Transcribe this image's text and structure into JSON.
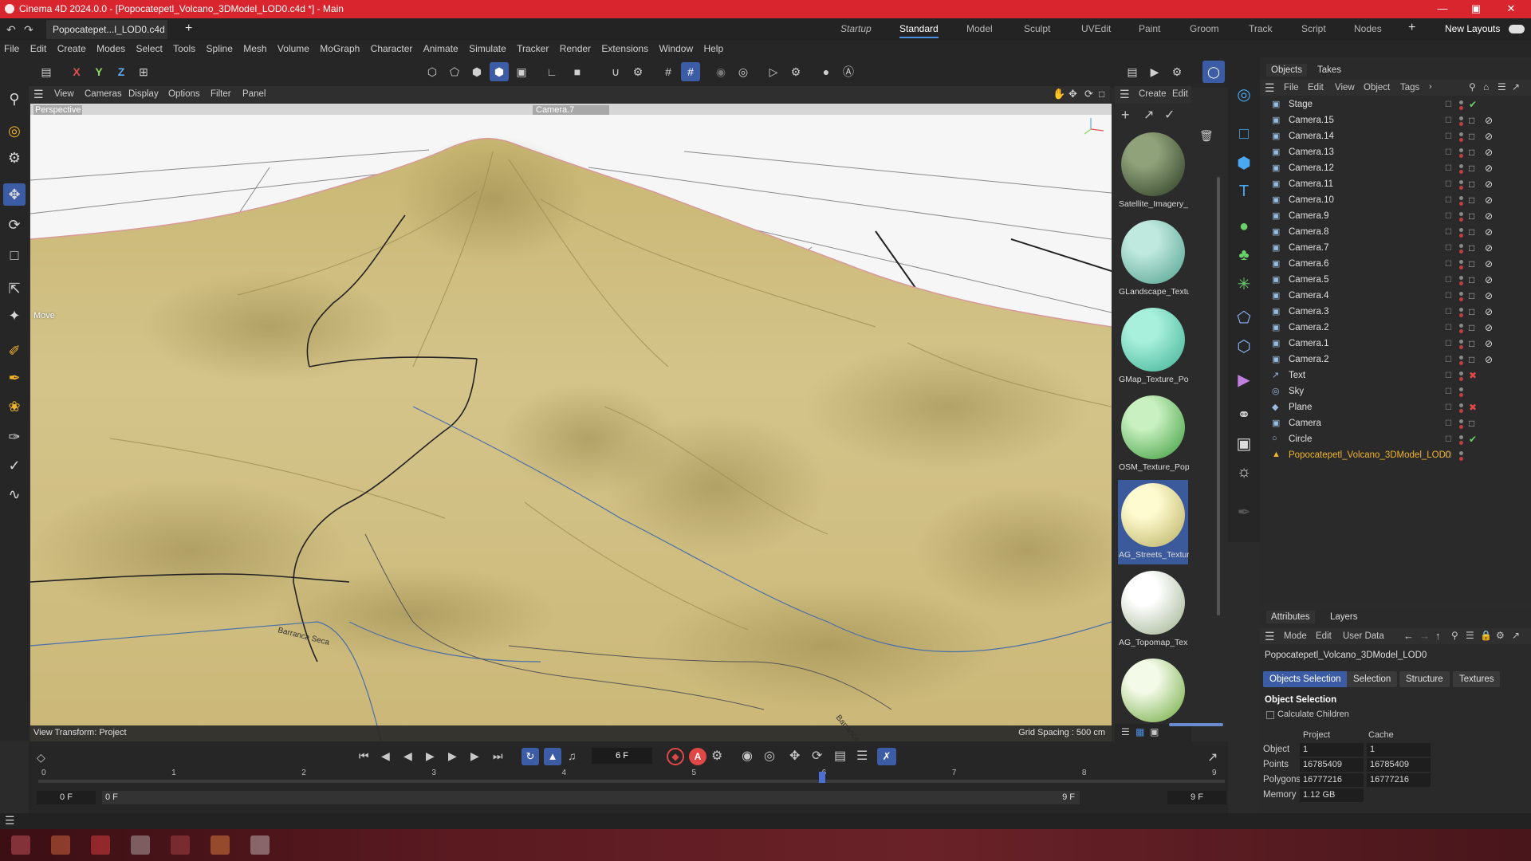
{
  "app": {
    "title": "Cinema 4D 2024.0.0 - [Popocatepetl_Volcano_3DModel_LOD0.c4d *] - Main",
    "doc_tab": "Popocatepet...l_LOD0.c4d *",
    "accent_color": "#3d5ca6",
    "title_bar_color": "#d9262e"
  },
  "layouts": [
    "Startup",
    "Standard",
    "Model",
    "Sculpt",
    "UVEdit",
    "Paint",
    "Groom",
    "Track",
    "Script",
    "Nodes"
  ],
  "new_layouts": "New Layouts",
  "menu": [
    "File",
    "Edit",
    "Create",
    "Modes",
    "Select",
    "Tools",
    "Spline",
    "Mesh",
    "Volume",
    "MoGraph",
    "Character",
    "Animate",
    "Simulate",
    "Tracker",
    "Render",
    "Extensions",
    "Window",
    "Help"
  ],
  "axis_buttons": {
    "x": "X",
    "y": "Y",
    "z": "Z"
  },
  "viewport": {
    "menu": [
      "View",
      "Cameras",
      "Display",
      "Options",
      "Filter",
      "Panel"
    ],
    "name": "Perspective",
    "camera": "Camera.7",
    "hud_move": "Move",
    "view_transform": "View Transform: Project",
    "grid_spacing": "Grid Spacing : 500 cm",
    "road_label_1": "Barranca Seca",
    "road_label_2": "Barranca Sa"
  },
  "materials": {
    "menu": [
      "Create",
      "Edit"
    ],
    "items": [
      {
        "label": "Satellite_Imagery_",
        "c1": "#8fa27a",
        "c2": "#2a3a22"
      },
      {
        "label": "GLandscape_Textu",
        "c1": "#bfe8de",
        "c2": "#4fa08e"
      },
      {
        "label": "GMap_Texture_Po",
        "c1": "#a8f0dc",
        "c2": "#3fb094"
      },
      {
        "label": "OSM_Texture_Pop",
        "c1": "#c8f0c0",
        "c2": "#3a9a3a"
      },
      {
        "label": "AG_Streets_Textur",
        "c1": "#fffbd0",
        "c2": "#b8ae60"
      },
      {
        "label": "AG_Topomap_Tex",
        "c1": "#ffffff",
        "c2": "#9aae8a"
      },
      {
        "label": "",
        "c1": "#f4fae8",
        "c2": "#6aa83a"
      }
    ]
  },
  "objects": {
    "tabs": [
      "Objects",
      "Takes"
    ],
    "menu": [
      "File",
      "Edit",
      "View",
      "Object",
      "Tags"
    ],
    "items": [
      "Stage",
      "Camera.15",
      "Camera.14",
      "Camera.13",
      "Camera.12",
      "Camera.11",
      "Camera.10",
      "Camera.9",
      "Camera.8",
      "Camera.7",
      "Camera.6",
      "Camera.5",
      "Camera.4",
      "Camera.3",
      "Camera.2",
      "Camera.1",
      "Camera.2",
      "Text",
      "Sky",
      "Plane",
      "Camera",
      "Circle",
      "Popocatepetl_Volcano_3DModel_LOD0"
    ],
    "highlight_color": "#f0b429"
  },
  "attributes": {
    "tabs": [
      "Attributes",
      "Layers"
    ],
    "menu": [
      "Mode",
      "Edit",
      "User Data"
    ],
    "object_name": "Popocatepetl_Volcano_3DModel_LOD0",
    "buttons": [
      "Objects Selection",
      "Selection",
      "Structure",
      "Textures"
    ],
    "section": "Object Selection",
    "calc_children": "Calculate Children",
    "col_project": "Project",
    "col_cache": "Cache",
    "rows": [
      {
        "label": "Object",
        "project": "1",
        "cache": "1"
      },
      {
        "label": "Points",
        "project": "16785409",
        "cache": "16785409"
      },
      {
        "label": "Polygons",
        "project": "16777216",
        "cache": "16777216"
      },
      {
        "label": "Memory",
        "project": "1.12 GB",
        "cache": ""
      }
    ]
  },
  "timeline": {
    "current_frame": "6 F",
    "start": "0 F",
    "start2": "0 F",
    "end": "9 F",
    "end2": "9 F",
    "ticks": [
      "0",
      "1",
      "2",
      "3",
      "4",
      "5",
      "6",
      "7",
      "8",
      "9"
    ],
    "playhead_frame": 6
  }
}
